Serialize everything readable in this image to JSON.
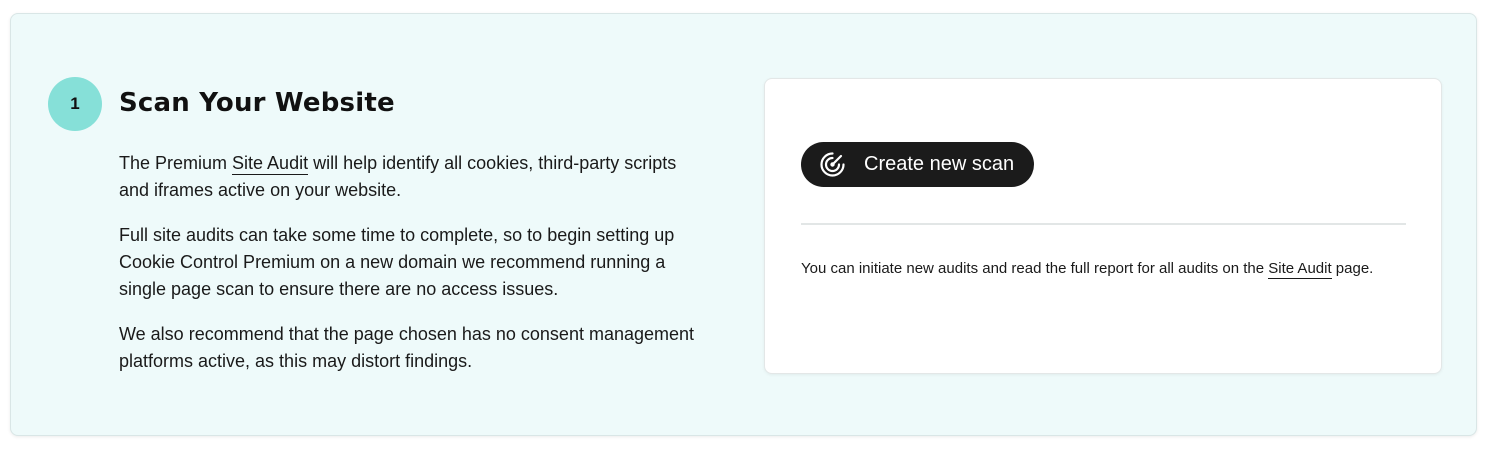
{
  "step": {
    "number": "1",
    "title": "Scan Your Website",
    "paragraph1_before": "The Premium ",
    "paragraph1_link": "Site Audit",
    "paragraph1_after": " will help identify all cookies, third-party scripts and iframes active on your website.",
    "paragraph2": "Full site audits can take some time to complete, so to begin setting up Cookie Control Premium on a new domain we recommend running a single page scan to ensure there are no access issues.",
    "paragraph3": "We also recommend that the page chosen has no consent management platforms active, as this may distort findings."
  },
  "card": {
    "button_label": "Create new scan",
    "button_icon": "radar-icon",
    "note_before": "You can initiate new audits and read the full report for all audits on the ",
    "note_link": "Site Audit",
    "note_after": " page."
  },
  "colors": {
    "panel_background": "#eefafa",
    "badge": "#86e0d8",
    "button": "#1b1b1b"
  }
}
